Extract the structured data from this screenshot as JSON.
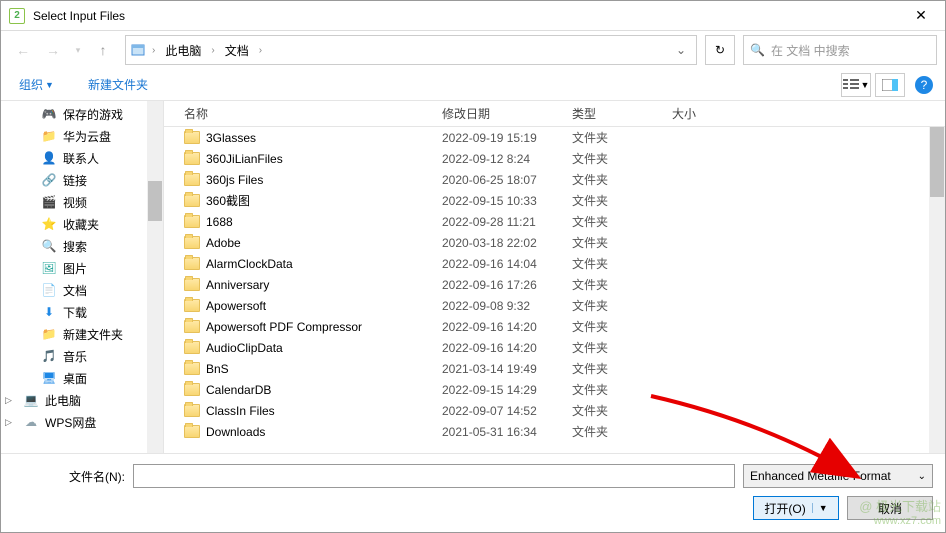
{
  "window": {
    "title": "Select Input Files",
    "app_icon_label": "2"
  },
  "nav": {
    "breadcrumb_root": "此电脑",
    "breadcrumb_folder": "文档",
    "search_placeholder": "在 文档 中搜索"
  },
  "toolbar": {
    "organize": "组织",
    "new_folder": "新建文件夹"
  },
  "sidebar": {
    "items": [
      {
        "label": "保存的游戏",
        "icon": "🎮",
        "level": 1
      },
      {
        "label": "华为云盘",
        "icon": "📁",
        "level": 1
      },
      {
        "label": "联系人",
        "icon": "👤",
        "level": 1
      },
      {
        "label": "链接",
        "icon": "🔗",
        "level": 1
      },
      {
        "label": "视频",
        "icon": "🎬",
        "level": 1
      },
      {
        "label": "收藏夹",
        "icon": "⭐",
        "level": 1
      },
      {
        "label": "搜索",
        "icon": "🔍",
        "level": 1
      },
      {
        "label": "图片",
        "icon": "🖼",
        "level": 1
      },
      {
        "label": "文档",
        "icon": "📄",
        "level": 1
      },
      {
        "label": "下载",
        "icon": "⬇",
        "level": 1
      },
      {
        "label": "新建文件夹",
        "icon": "📁",
        "level": 1
      },
      {
        "label": "音乐",
        "icon": "🎵",
        "level": 1
      },
      {
        "label": "桌面",
        "icon": "🖥",
        "level": 1
      },
      {
        "label": "此电脑",
        "icon": "💻",
        "level": 0,
        "expand": true
      },
      {
        "label": "WPS网盘",
        "icon": "☁",
        "level": 0,
        "expand": true
      }
    ]
  },
  "columns": {
    "name": "名称",
    "date": "修改日期",
    "type": "类型",
    "size": "大小"
  },
  "files": [
    {
      "name": "3Glasses",
      "date": "2022-09-19 15:19",
      "type": "文件夹"
    },
    {
      "name": "360JiLianFiles",
      "date": "2022-09-12 8:24",
      "type": "文件夹"
    },
    {
      "name": "360js Files",
      "date": "2020-06-25 18:07",
      "type": "文件夹"
    },
    {
      "name": "360截图",
      "date": "2022-09-15 10:33",
      "type": "文件夹"
    },
    {
      "name": "1688",
      "date": "2022-09-28 11:21",
      "type": "文件夹"
    },
    {
      "name": "Adobe",
      "date": "2020-03-18 22:02",
      "type": "文件夹"
    },
    {
      "name": "AlarmClockData",
      "date": "2022-09-16 14:04",
      "type": "文件夹"
    },
    {
      "name": "Anniversary",
      "date": "2022-09-16 17:26",
      "type": "文件夹"
    },
    {
      "name": "Apowersoft",
      "date": "2022-09-08 9:32",
      "type": "文件夹"
    },
    {
      "name": "Apowersoft PDF Compressor",
      "date": "2022-09-16 14:20",
      "type": "文件夹"
    },
    {
      "name": "AudioClipData",
      "date": "2022-09-16 14:20",
      "type": "文件夹"
    },
    {
      "name": "BnS",
      "date": "2021-03-14 19:49",
      "type": "文件夹"
    },
    {
      "name": "CalendarDB",
      "date": "2022-09-15 14:29",
      "type": "文件夹"
    },
    {
      "name": "ClassIn Files",
      "date": "2022-09-07 14:52",
      "type": "文件夹"
    },
    {
      "name": "Downloads",
      "date": "2021-05-31 16:34",
      "type": "文件夹"
    }
  ],
  "bottom": {
    "filename_label": "文件名(N):",
    "filetype_label": "Enhanced Metafile Format",
    "open": "打开(O)",
    "cancel": "取消"
  },
  "watermark": {
    "line1": "@ 极光下载站",
    "line2": "www.xz7.com"
  }
}
